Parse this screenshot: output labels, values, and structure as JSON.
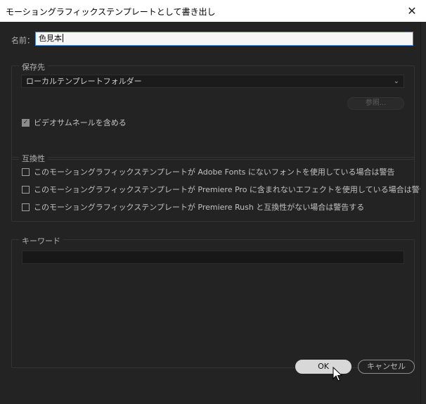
{
  "window": {
    "title": "モーショングラフィックステンプレートとして書き出し",
    "close_glyph": "✕"
  },
  "name_field": {
    "label": "名前：",
    "value": "色見本"
  },
  "destination": {
    "group_title": "保存先",
    "dropdown_value": "ローカルテンプレートフォルダー",
    "browse_label": "参照...",
    "include_thumbnail_label": "ビデオサムネールを含める",
    "include_thumbnail_checked": true
  },
  "compatibility": {
    "group_title": "互換性",
    "options": [
      {
        "label": "このモーショングラフィックステンプレートが Adobe Fonts にないフォントを使用している場合は警告",
        "checked": false
      },
      {
        "label": "このモーショングラフィックステンプレートが Premiere Pro に含まれないエフェクトを使用している場合は警告",
        "checked": false
      },
      {
        "label": "このモーショングラフィックステンプレートが Premiere Rush と互換性がない場合は警告する",
        "checked": false
      }
    ]
  },
  "keywords": {
    "group_title": "キーワード",
    "value": ""
  },
  "buttons": {
    "ok_label": "OK",
    "cancel_label": "キャンセル"
  },
  "icons": {
    "close": "close-icon",
    "dropdown": "chevron-down-icon",
    "checkmark": "checkmark-icon",
    "cursor": "mouse-pointer-icon"
  },
  "colors": {
    "dialog_bg": "#232323",
    "title_bar_bg": "#ffffff",
    "input_focus_border": "#4b8fd6",
    "ok_button_bg": "#d8d8d8"
  }
}
